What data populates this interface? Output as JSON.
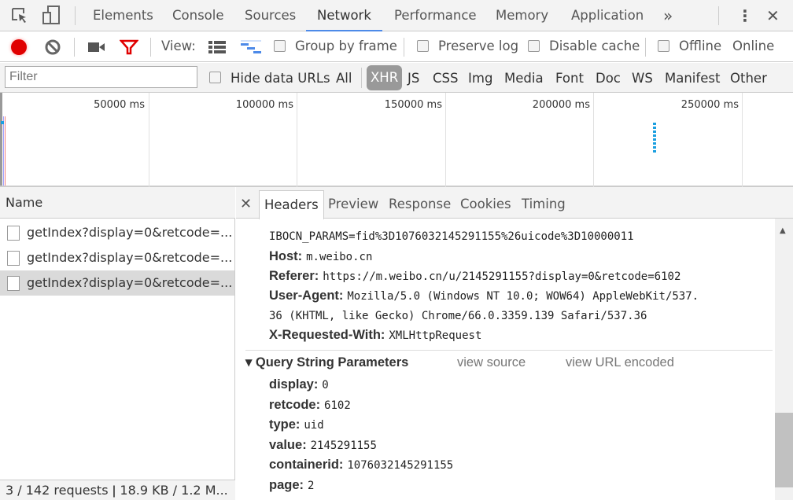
{
  "tabs": [
    "Elements",
    "Console",
    "Sources",
    "Network",
    "Performance",
    "Memory",
    "Application"
  ],
  "active_tab": "Network",
  "more_tabs": "»",
  "toolbar": {
    "view_label": "View:",
    "group_by_frame": "Group by frame",
    "preserve_log": "Preserve log",
    "disable_cache": "Disable cache",
    "offline": "Offline",
    "throttle": "Online"
  },
  "filter": {
    "placeholder": "Filter",
    "hide_data_urls": "Hide data URLs",
    "types": [
      "All",
      "XHR",
      "JS",
      "CSS",
      "Img",
      "Media",
      "Font",
      "Doc",
      "WS",
      "Manifest",
      "Other"
    ],
    "selected": "XHR"
  },
  "overview": {
    "ticks": [
      "50000 ms",
      "100000 ms",
      "150000 ms",
      "200000 ms",
      "250000 ms"
    ]
  },
  "requests": {
    "header": "Name",
    "rows": [
      "getIndex?display=0&retcode=...",
      "getIndex?display=0&retcode=...",
      "getIndex?display=0&retcode=..."
    ],
    "selected_index": 2
  },
  "footer": "3 / 142 requests  ǀ  18.9 KB / 1.2 M...",
  "detail": {
    "tabs": [
      "Headers",
      "Preview",
      "Response",
      "Cookies",
      "Timing"
    ],
    "active": "Headers",
    "cookie_tail": "IBOCN_PARAMS=fid%3D1076032145291155%26uicode%3D10000011",
    "headers": [
      {
        "k": "Host:",
        "v": "m.weibo.cn"
      },
      {
        "k": "Referer:",
        "v": "https://m.weibo.cn/u/2145291155?display=0&retcode=6102"
      },
      {
        "k": "User-Agent:",
        "v": "Mozilla/5.0 (Windows NT 10.0; WOW64) AppleWebKit/537."
      },
      {
        "k": "",
        "v": "36 (KHTML, like Gecko) Chrome/66.0.3359.139 Safari/537.36"
      },
      {
        "k": "X-Requested-With:",
        "v": "XMLHttpRequest"
      }
    ],
    "query_title": "Query String Parameters",
    "view_source": "view source",
    "view_url_encoded": "view URL encoded",
    "params": [
      {
        "k": "display:",
        "v": "0"
      },
      {
        "k": "retcode:",
        "v": "6102"
      },
      {
        "k": "type:",
        "v": "uid"
      },
      {
        "k": "value:",
        "v": "2145291155"
      },
      {
        "k": "containerid:",
        "v": "1076032145291155"
      },
      {
        "k": "page:",
        "v": "2"
      }
    ]
  },
  "colors": {
    "record": "#e00000",
    "filter_active": "#e00000",
    "accent": "#4d8ae8"
  }
}
